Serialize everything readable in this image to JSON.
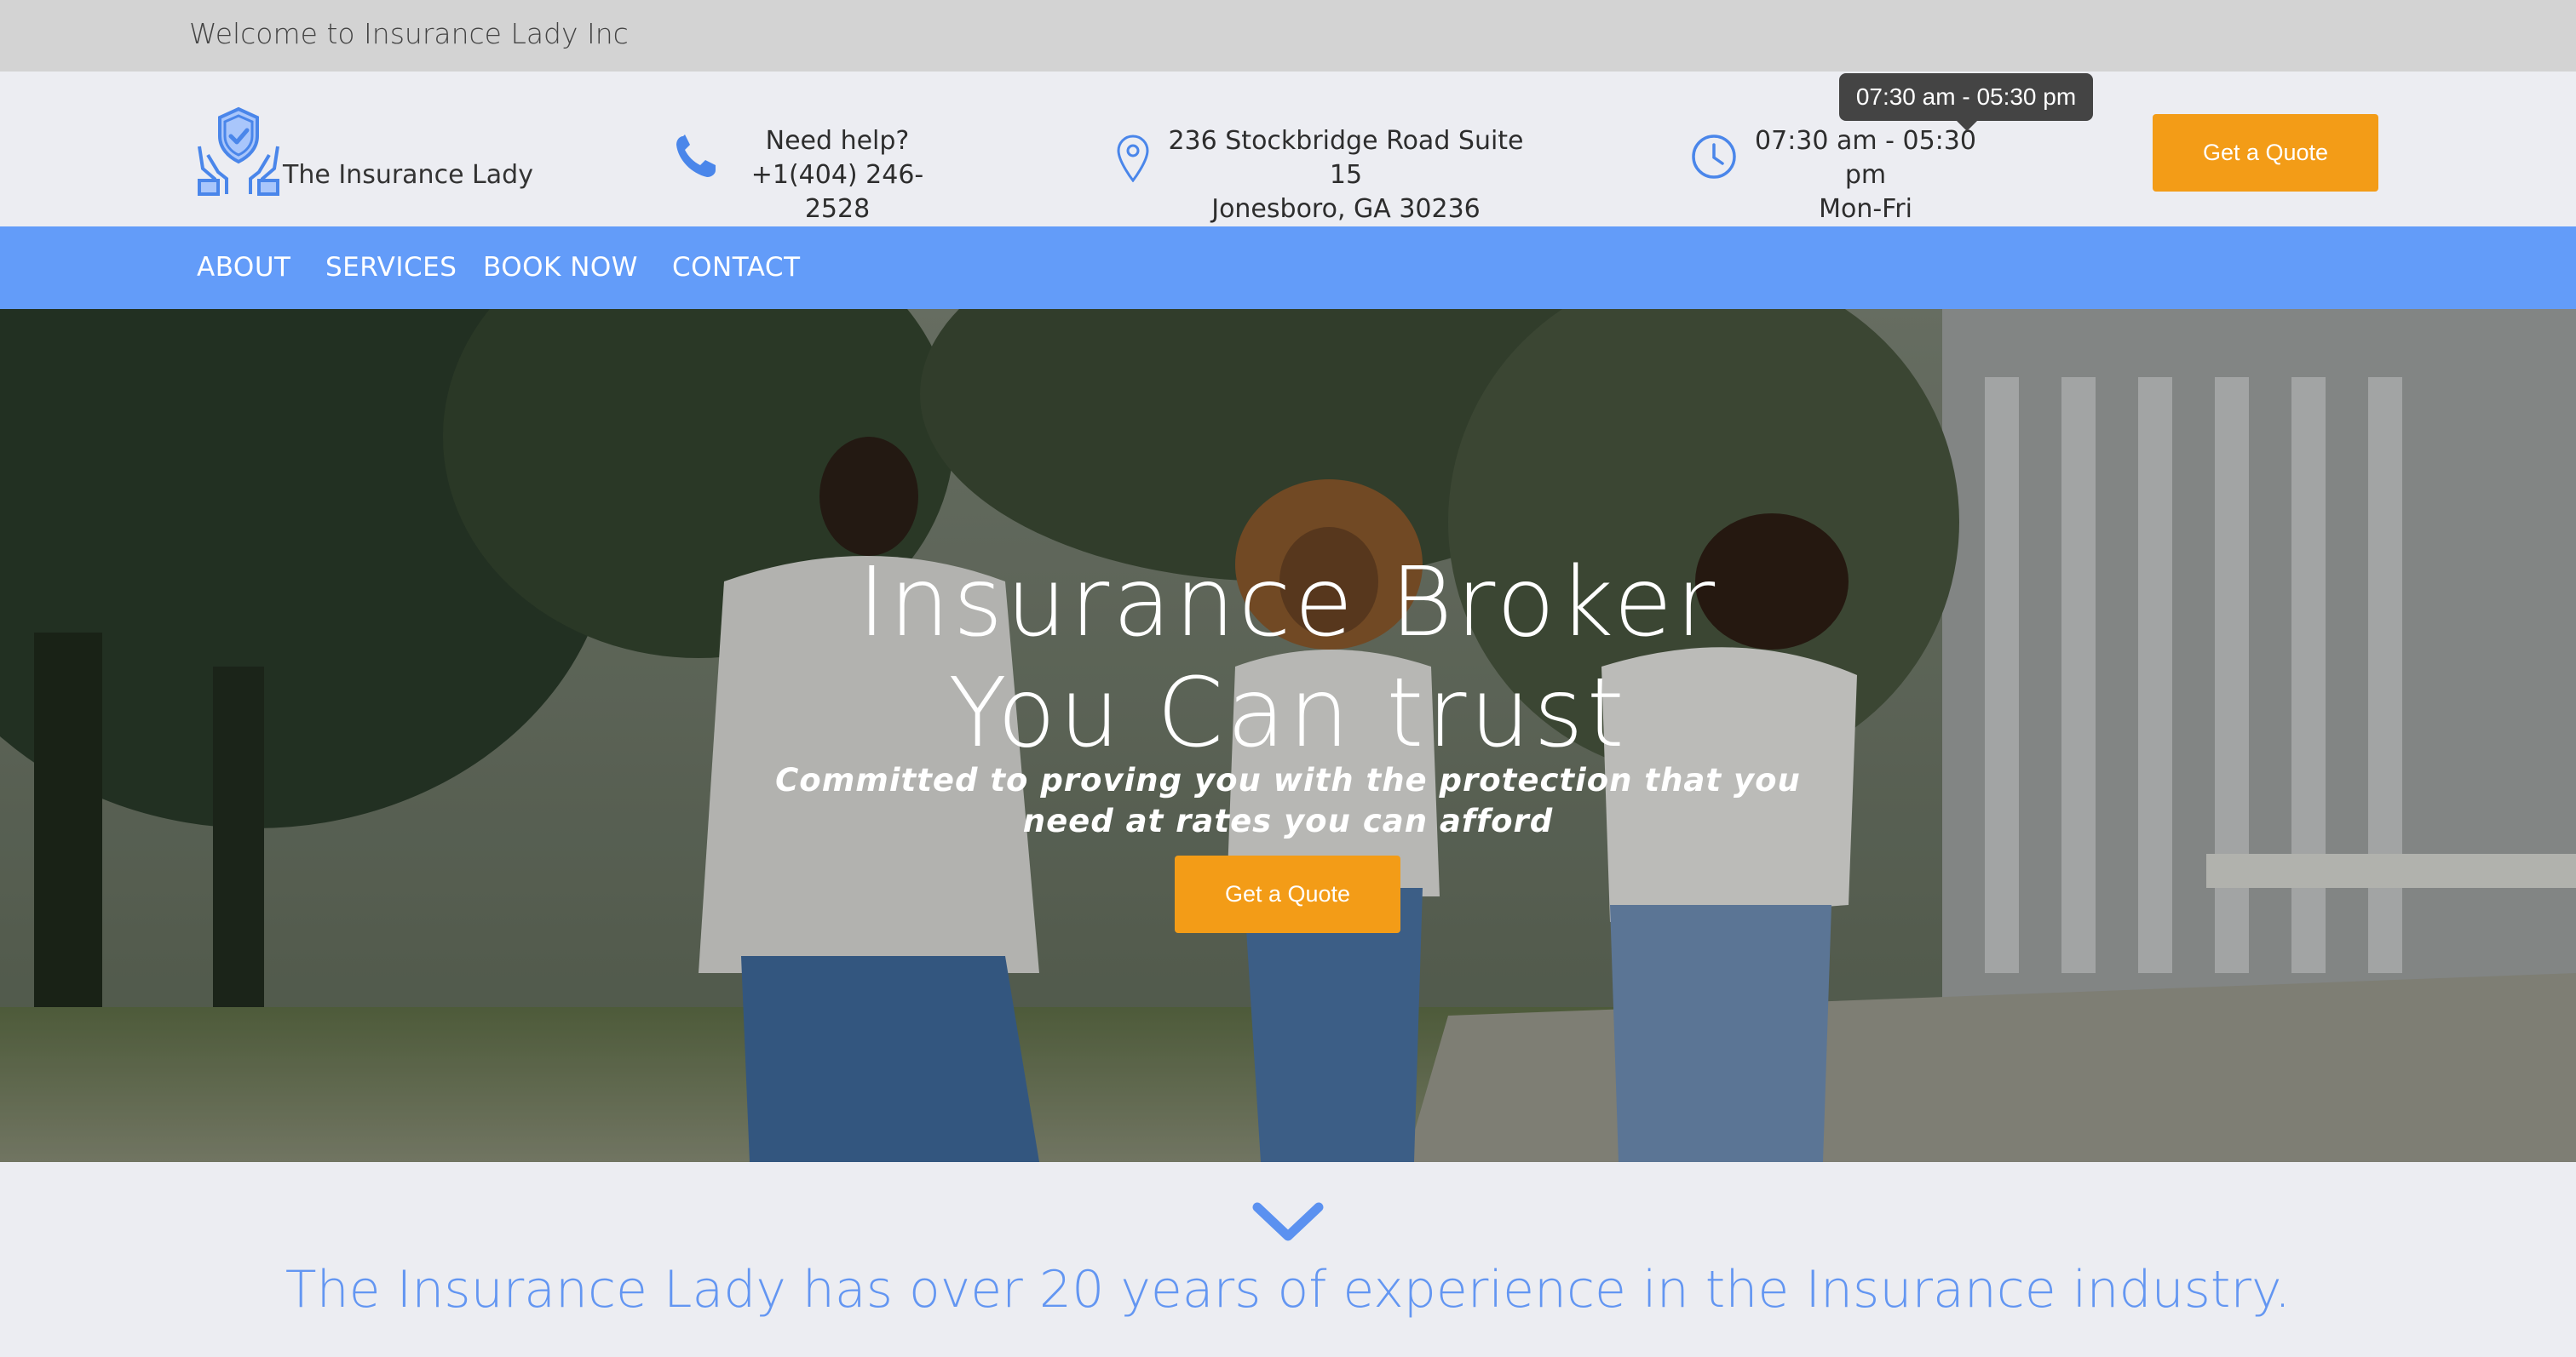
{
  "topbar": {
    "welcome": "Welcome to Insurance Lady Inc"
  },
  "header": {
    "logo_text": "The Insurance Lady",
    "phone": {
      "label": "Need help?",
      "value": "+1(404) 246-2528"
    },
    "address": {
      "line1": "236 Stockbridge Road Suite 15",
      "line2": "Jonesboro, GA 30236"
    },
    "hours": {
      "time": "07:30 am - 05:30 pm",
      "days": "Mon-Fri"
    },
    "tooltip": "07:30 am - 05:30 pm",
    "quote_button": "Get a Quote"
  },
  "nav": {
    "items": [
      "ABOUT",
      "SERVICES",
      "BOOK NOW",
      "CONTACT"
    ]
  },
  "hero": {
    "title_line1": "Insurance Broker",
    "title_line2": "You Can trust",
    "subtitle": "Committed to proving you with the protection that you need at rates you can afford",
    "quote_button": "Get a Quote"
  },
  "tagline": "The Insurance Lady has over 20 years of experience in the Insurance industry.",
  "colors": {
    "accent": "#639cf9",
    "button": "#f39c17",
    "tagline": "#6396f2"
  },
  "icons": [
    "shield-hands-icon",
    "phone-icon",
    "map-pin-icon",
    "clock-icon",
    "chevron-down-icon"
  ]
}
